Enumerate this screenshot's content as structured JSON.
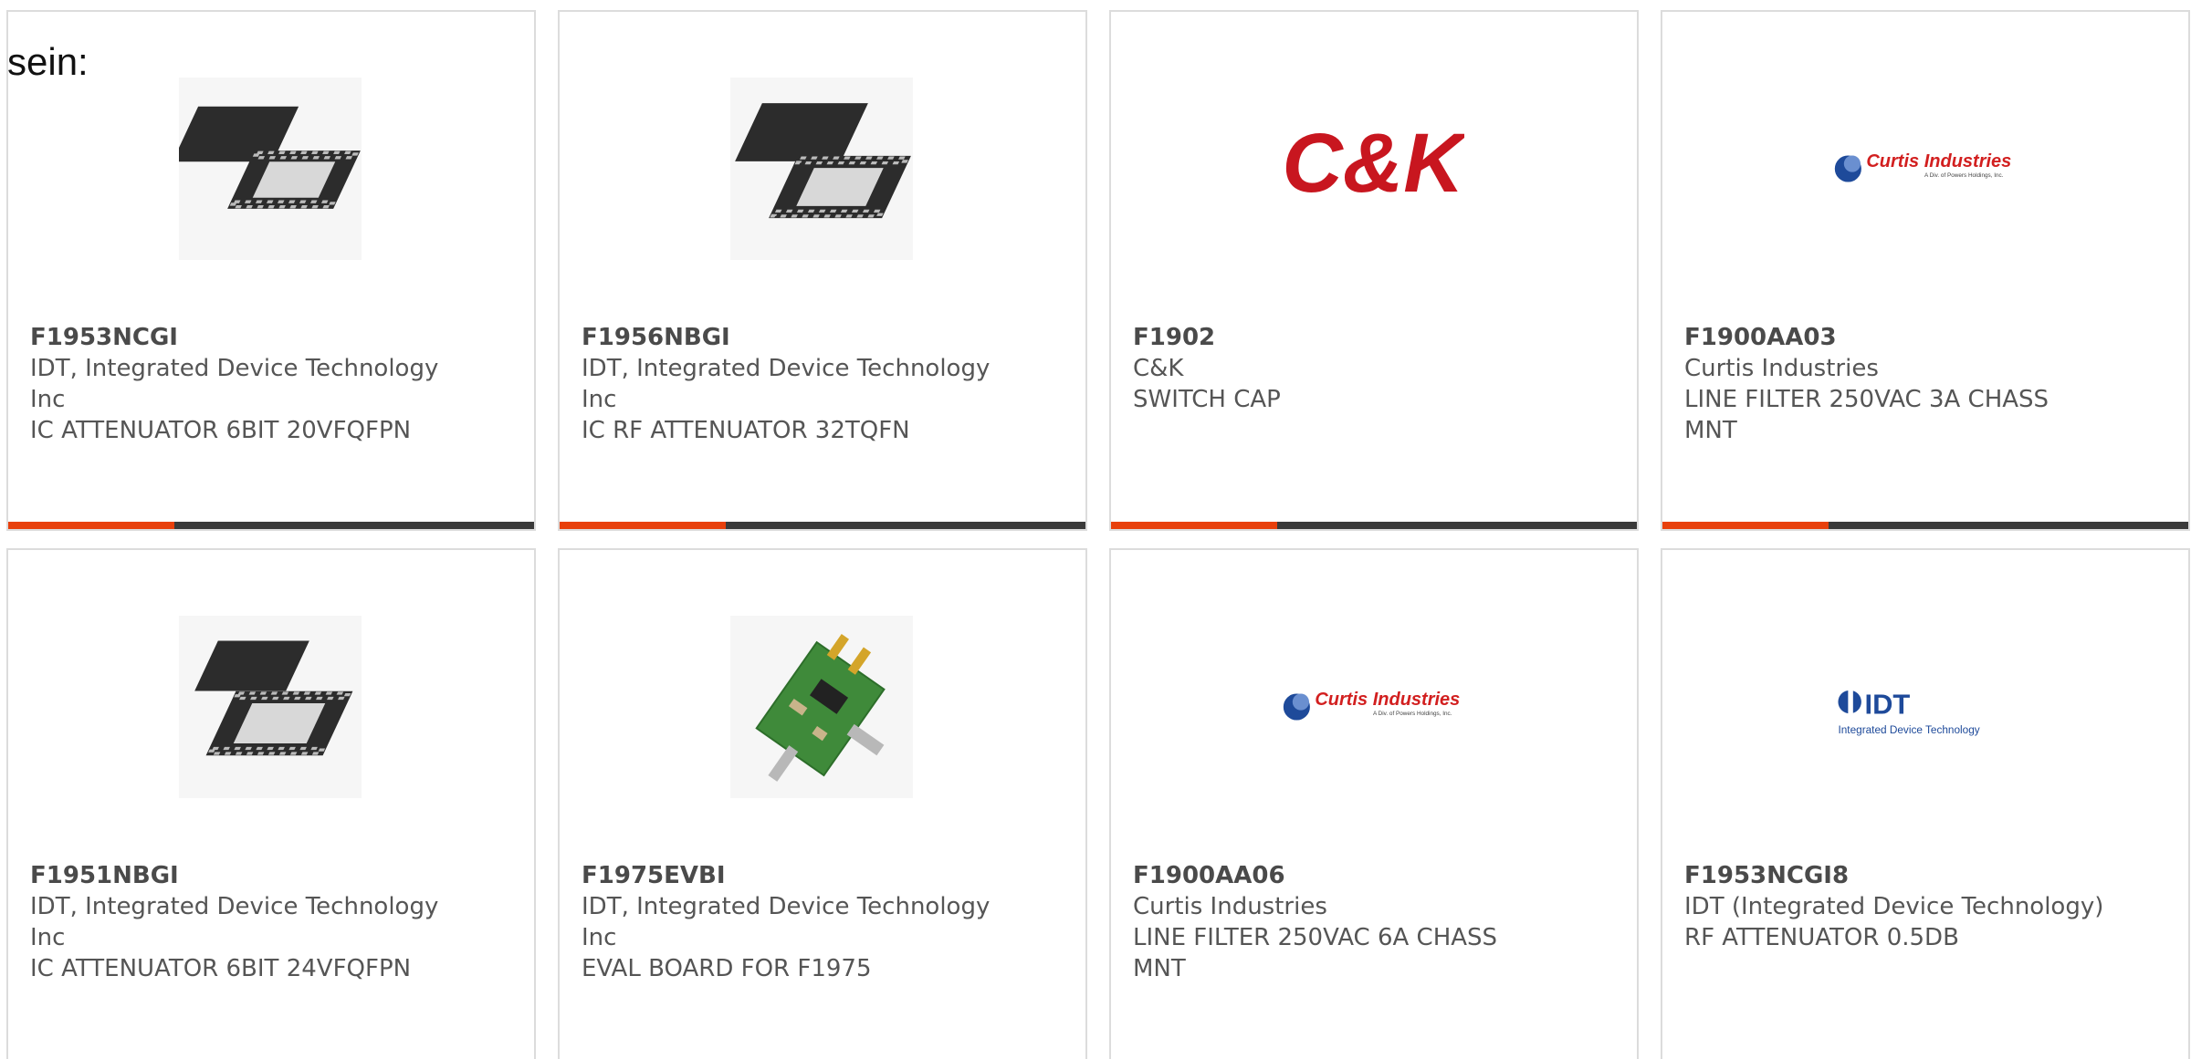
{
  "heading": "sein:",
  "colors": {
    "accent": "#e8400c",
    "bar": "#3a3a3a",
    "border": "#dcdcdc",
    "text": "#555555",
    "ck_red": "#c8161f",
    "curtis_red": "#d21f1f",
    "idt_blue": "#1e4a9a"
  },
  "products": [
    {
      "part": "F1953NCGI",
      "manufacturer": "IDT, Integrated Device Technology Inc",
      "description": "IC ATTENUATOR 6BIT 20VFQFPN",
      "image": "qfn-chip-icon"
    },
    {
      "part": "F1956NBGI",
      "manufacturer": "IDT, Integrated Device Technology Inc",
      "description": "IC RF ATTENUATOR 32TQFN",
      "image": "qfn-chip-icon"
    },
    {
      "part": "F1902",
      "manufacturer": "C&K",
      "description": "SWITCH CAP",
      "image": "ck-logo",
      "logo_text": "C&K"
    },
    {
      "part": "F1900AA03",
      "manufacturer": "Curtis Industries",
      "description": "LINE FILTER 250VAC 3A CHASS MNT",
      "image": "curtis-logo",
      "logo_text": "Curtis Industries",
      "logo_subtext": "A Div. of Powers Holdings, Inc."
    },
    {
      "part": "F1951NBGI",
      "manufacturer": "IDT, Integrated Device Technology Inc",
      "description": "IC ATTENUATOR 6BIT 24VFQFPN",
      "image": "qfn-chip-icon"
    },
    {
      "part": "F1975EVBI",
      "manufacturer": "IDT, Integrated Device Technology Inc",
      "description": "EVAL BOARD FOR F1975",
      "image": "eval-board-icon"
    },
    {
      "part": "F1900AA06",
      "manufacturer": "Curtis Industries",
      "description": "LINE FILTER 250VAC 6A CHASS MNT",
      "image": "curtis-logo",
      "logo_text": "Curtis Industries",
      "logo_subtext": "A Div. of Powers Holdings, Inc."
    },
    {
      "part": "F1953NCGI8",
      "manufacturer": "IDT (Integrated Device Technology)",
      "description": "RF ATTENUATOR 0.5DB",
      "image": "idt-logo",
      "logo_text": "IDT",
      "logo_subtext": "Integrated Device Technology"
    }
  ]
}
